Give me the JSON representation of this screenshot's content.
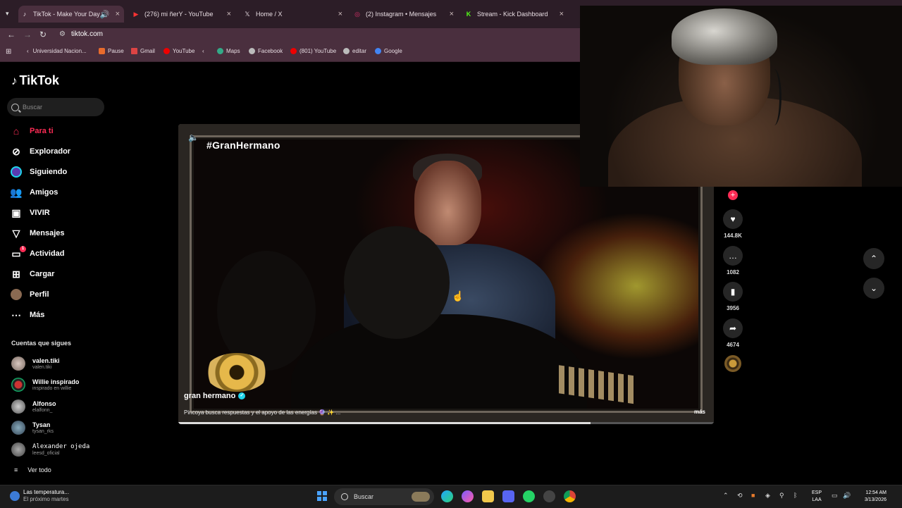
{
  "browser": {
    "tabs": [
      {
        "title": "TikTok - Make Your Day",
        "icon": "tiktok-icon",
        "active": true
      },
      {
        "title": "(276) mi ñerY - YouTube",
        "icon": "youtube-icon"
      },
      {
        "title": "Home / X",
        "icon": "x-icon"
      },
      {
        "title": "(2) Instagram • Mensajes",
        "icon": "instagram-icon"
      },
      {
        "title": "Stream - Kick Dashboard",
        "icon": "kick-icon"
      }
    ],
    "url": "tiktok.com",
    "bookmarks": [
      {
        "label": "Universidad Nacion...",
        "color": "#b33"
      },
      {
        "label": "Pause",
        "color": "#e86b2c"
      },
      {
        "label": "Gmail",
        "color": "#d44"
      },
      {
        "label": "YouTube",
        "color": "#e00"
      },
      {
        "label": "Maps",
        "color": "#3a8"
      },
      {
        "label": "Facebook",
        "color": "#bbb"
      },
      {
        "label": "(801) YouTube",
        "color": "#e00"
      },
      {
        "label": "editar",
        "color": "#bbb"
      },
      {
        "label": "Google",
        "color": "#4285f4"
      }
    ]
  },
  "tiktok": {
    "logo": "TikTok",
    "search_placeholder": "Buscar",
    "menu": [
      {
        "label": "Para ti",
        "icon": "home-icon",
        "active": true
      },
      {
        "label": "Explorador",
        "icon": "compass-icon"
      },
      {
        "label": "Siguiendo",
        "icon": "following-icon"
      },
      {
        "label": "Amigos",
        "icon": "friends-icon"
      },
      {
        "label": "VIVIR",
        "icon": "live-icon"
      },
      {
        "label": "Mensajes",
        "icon": "send-icon"
      },
      {
        "label": "Actividad",
        "icon": "activity-icon",
        "badge": "1"
      },
      {
        "label": "Cargar",
        "icon": "upload-icon"
      },
      {
        "label": "Perfil",
        "icon": "profile-avatar-icon"
      },
      {
        "label": "Más",
        "icon": "more-icon"
      }
    ],
    "following_title": "Cuentas que sigues",
    "following": [
      {
        "name": "valen.tiki",
        "handle": "valen.tiki"
      },
      {
        "name": "Willie inspirado",
        "handle": "inspirado en willie"
      },
      {
        "name": "Alfonso",
        "handle": "elalfonn_"
      },
      {
        "name": "Tysan",
        "handle": "tysan_rks"
      },
      {
        "name": "Alexander ojeda",
        "handle": "leesd_oficial"
      }
    ],
    "see_all": "Ver todo",
    "video": {
      "hashtag": "#GranHermano",
      "author": "gran hermano",
      "description": "Pincoya busca respuestas y el apoyo de las energías 🔮 ✨ ...",
      "more": "más",
      "progress": 0.77
    },
    "actions": {
      "likes": "144.8K",
      "comments": "1082",
      "saves": "3956",
      "shares": "4674"
    }
  },
  "taskbar": {
    "weather_line1": "Las temperatura...",
    "weather_line2": "El próximo martes",
    "search": "Buscar",
    "lang1": "ESP",
    "lang2": "LAA",
    "time": "12:54 AM",
    "date": "3/13/2026"
  }
}
